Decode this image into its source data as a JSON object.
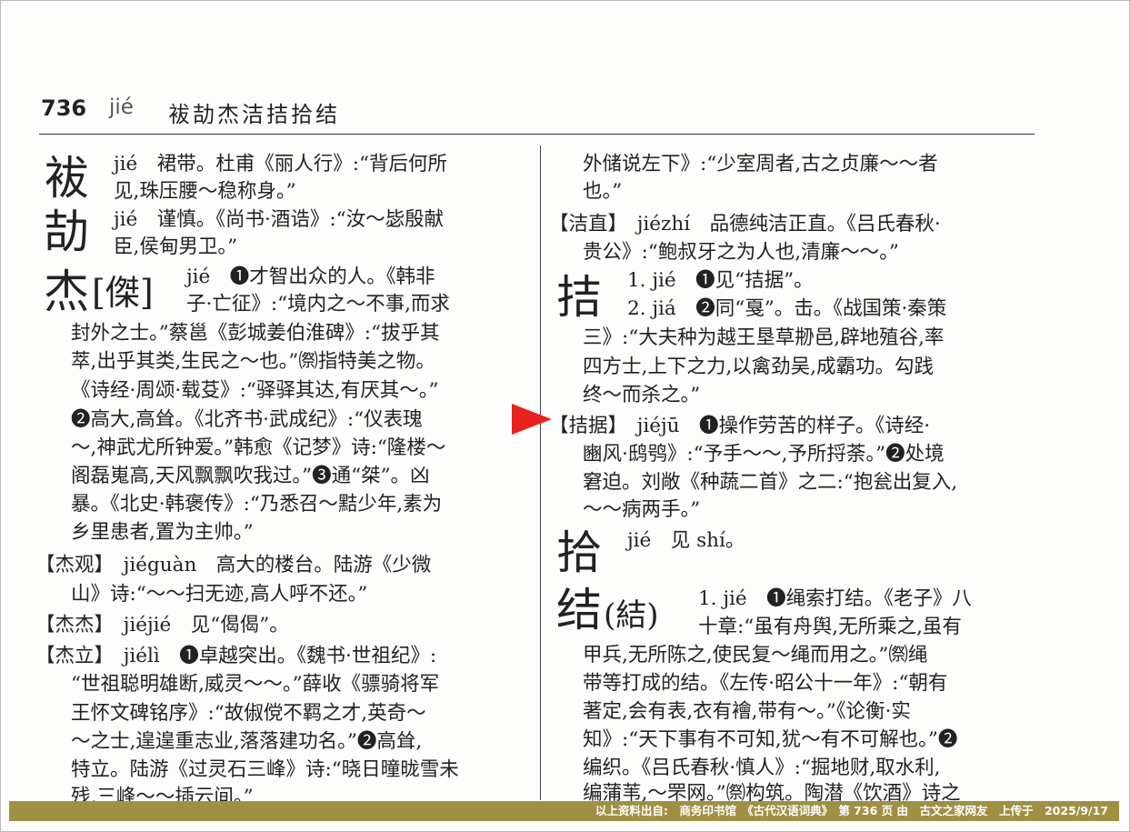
{
  "header": {
    "page_number": "736",
    "pinyin": "jié",
    "chars": "袚劼杰洁拮拾结"
  },
  "left": {
    "big_fu": "袚",
    "big_jie2": "劼",
    "big_jie3": "杰",
    "jie3_variant": "[傑]",
    "lines": [
      "jié　裙带。杜甫《丽人行》:“背后何所",
      "见,珠压腰～稳称身。”",
      "jié　谨慎。《尚书·酒诰》:“汝～毖殷献",
      "臣,侯甸男卫。”",
      "jié　❶才智出众的人。《韩非",
      "子·亡征》:“境内之～不事,而求",
      "封外之士。”蔡邕《彭城姜伯淮碑》:“拔乎其",
      "萃,出乎其类,生民之～也。”㉀指特美之物。",
      "《诗经·周颂·载芟》:“驿驿其达,有厌其～。”",
      "❷高大,高耸。《北齐书·武成纪》:“仪表瑰",
      "～,神武尤所钟爱。”韩愈《记梦》诗:“隆楼～",
      "阁磊嵬高,天风飘飘吹我过。”❸通“桀”。凶",
      "暴。《北史·韩褒传》:“乃悉召～黠少年,素为",
      "乡里患者,置为主帅。”",
      "【杰观】　jiéguàn　高大的楼台。陆游《少微",
      "山》诗:“～～扫无迹,高人呼不还。”",
      "【杰杰】　jiéjié　见“偈偈”。",
      "【杰立】　jiélì　❶卓越突出。《魏书·世祖纪》:",
      "“世祖聪明雄断,威灵～～。”薛收《骠骑将军",
      "王怀文碑铭序》:“故俶傥不羁之才,英奇～",
      "～之士,遑遑重志业,落落建功名。”❷高耸,",
      "特立。陆游《过灵石三峰》诗:“晓日曈昽雪未",
      "残,三峰～～插云间。”"
    ]
  },
  "right": {
    "big_jie_ji": "拮",
    "big_shi": "拾",
    "big_jie_knot": "结",
    "knot_variant": "(結)",
    "lines": [
      "外储说左下》:“少室周者,古之贞廉～～者",
      "也。”",
      "【洁直】　jiézhí　品德纯洁正直。《吕氏春秋·",
      "贵公》:“鲍叔牙之为人也,清廉～～。”",
      "1. jié　❶见“拮据”。",
      "2. jiá　❷同“戛”。击。《战国策·秦策",
      "三》:“大夫种为越王垦草刱邑,辟地殖谷,率",
      "四方士,上下之力,以禽劲吴,成霸功。勾践",
      "终～而杀之。”",
      "【拮据】　jiéjū　❶操作劳苦的样子。《诗经·",
      "豳风·鸱鸮》:“予手～～,予所捋荼。”❷处境",
      "窘迫。刘敞《种蔬二首》之二:“抱瓮出复入,",
      "～～病两手。”",
      "jié　见 shí。",
      "1. jié　❶绳索打结。《老子》八",
      "十章:“虽有舟舆,无所乘之,虽有",
      "甲兵,无所陈之,使民复～绳而用之。”㉀绳",
      "带等打成的结。《左传·昭公十一年》:“朝有",
      "著定,会有表,衣有襘,带有～。”《论衡·实",
      "知》:“天下事有不可知,犹～有不可解也。”❷",
      "编织。《吕氏春秋·慎人》:“掘地财,取水利,",
      "编蒲苇,～罘网。”㉀构筑。陶潜《饮酒》诗之"
    ]
  },
  "footer": {
    "text": "以上资料出自:　商务印书馆　《古代汉语词典》　第 736 页 由　古文之家网友　上传于　2025/9/17"
  },
  "colors": {
    "arrow": "#e8231f",
    "footer_bg": "#a09044"
  }
}
